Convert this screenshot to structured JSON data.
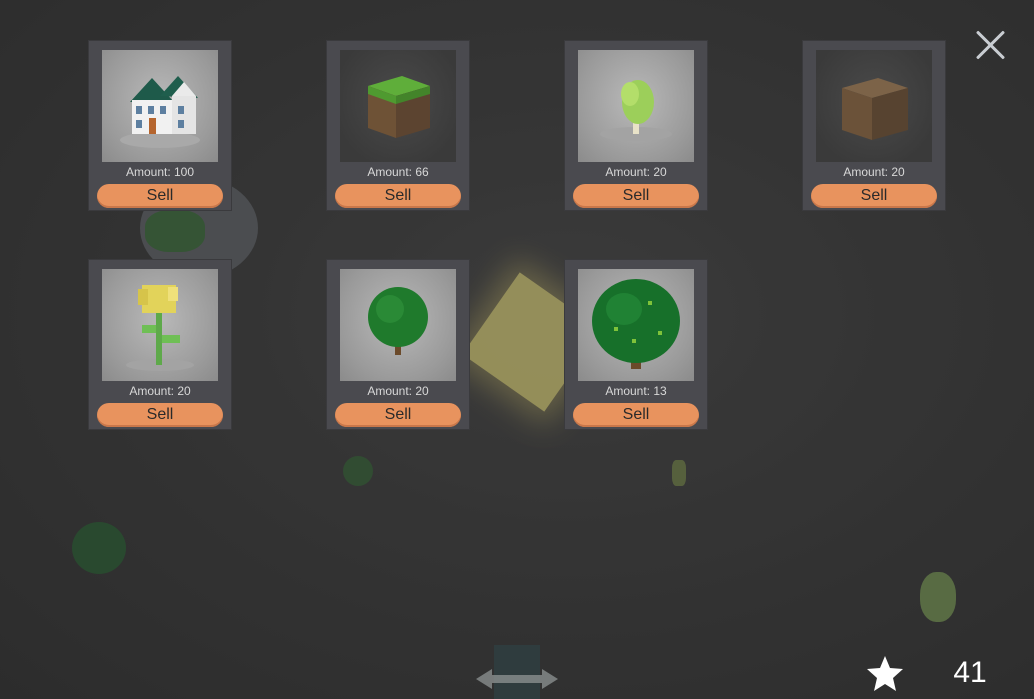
{
  "shop": {
    "items": [
      {
        "name": "House",
        "amount_text": "Amount: 100",
        "sell_label": "Sell",
        "icon": "house-icon"
      },
      {
        "name": "Grass Block",
        "amount_text": "Amount: 66",
        "sell_label": "Sell",
        "icon": "grass-block-icon"
      },
      {
        "name": "Small Tree",
        "amount_text": "Amount: 20",
        "sell_label": "Sell",
        "icon": "small-tree-icon"
      },
      {
        "name": "Dirt Block",
        "amount_text": "Amount: 20",
        "sell_label": "Sell",
        "icon": "dirt-block-icon"
      },
      {
        "name": "Flower",
        "amount_text": "Amount: 20",
        "sell_label": "Sell",
        "icon": "flower-icon"
      },
      {
        "name": "Bush Tree",
        "amount_text": "Amount: 20",
        "sell_label": "Sell",
        "icon": "bush-tree-icon"
      },
      {
        "name": "Big Tree",
        "amount_text": "Amount: 13",
        "sell_label": "Sell",
        "icon": "big-tree-icon"
      }
    ]
  },
  "hud": {
    "score": "41",
    "score_icon": "star-icon",
    "close_icon": "close-icon",
    "move_icon": "horizontal-arrows-icon"
  },
  "colors": {
    "sell_button": "#e8935e",
    "card_bg": "#4a4a4f",
    "background": "#3a3a3a"
  }
}
